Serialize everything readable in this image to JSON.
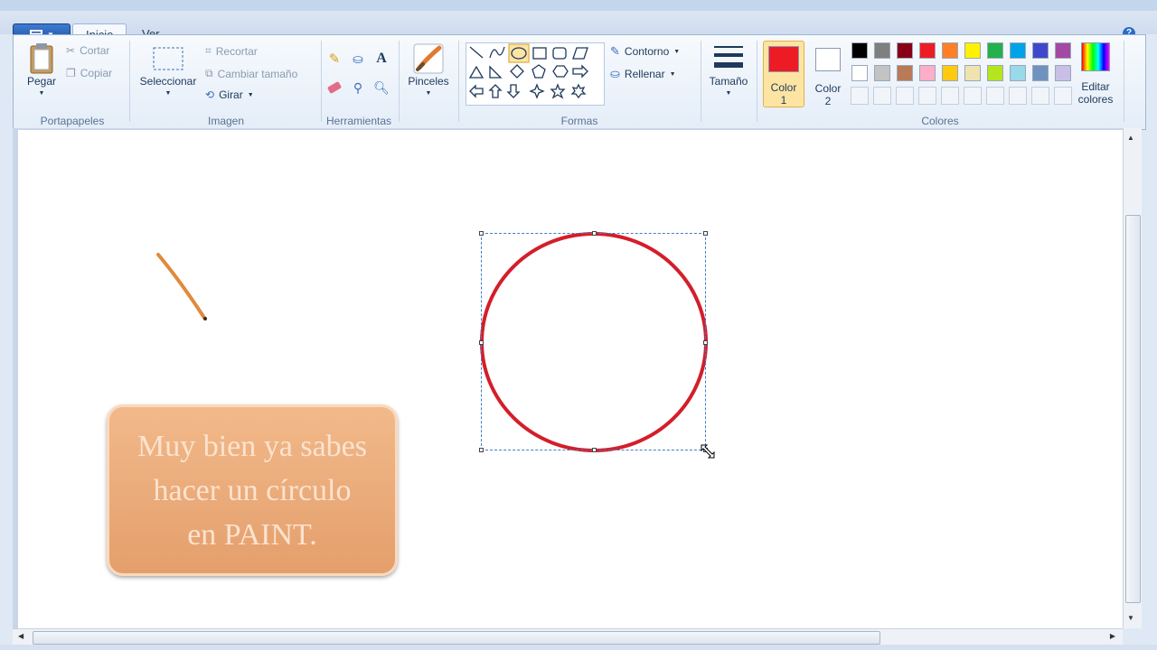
{
  "ribbon": {
    "tabs": [
      {
        "label": "Inicio",
        "active": true
      },
      {
        "label": "Ver",
        "active": false
      }
    ],
    "clipboard": {
      "paste": "Pegar",
      "cut": "Cortar",
      "copy": "Copiar",
      "group": "Portapapeles"
    },
    "image": {
      "select": "Seleccionar",
      "crop": "Recortar",
      "resize": "Cambiar tamaño",
      "rotate": "Girar",
      "group": "Imagen"
    },
    "tools": {
      "group": "Herramientas"
    },
    "brushes": {
      "label": "Pinceles"
    },
    "shapes": {
      "outline": "Contorno",
      "fill": "Rellenar",
      "group": "Formas"
    },
    "size": {
      "label": "Tamaño"
    },
    "colors": {
      "color1_line1": "Color",
      "color1_line2": "1",
      "color2_line1": "Color",
      "color2_line2": "2",
      "edit_line1": "Editar",
      "edit_line2": "colores",
      "group": "Colores",
      "color1": "#ed1c24",
      "color2": "#ffffff",
      "row1": [
        "#000000",
        "#7f7f7f",
        "#880015",
        "#ed1c24",
        "#ff7f27",
        "#fff200",
        "#22b14c",
        "#00a2e8",
        "#3f48cc",
        "#a349a4"
      ],
      "row2": [
        "#ffffff",
        "#c3c3c3",
        "#b97a57",
        "#ffaec9",
        "#ffc90e",
        "#efe4b0",
        "#b5e61d",
        "#99d9ea",
        "#7092be",
        "#c8bfe7"
      ]
    }
  },
  "canvas": {
    "callout_lines": [
      "Muy bien ya sabes",
      "hacer un círculo",
      "en PAINT."
    ],
    "circle_color": "#d41e2a",
    "stroke_color": "#e08a3c"
  }
}
